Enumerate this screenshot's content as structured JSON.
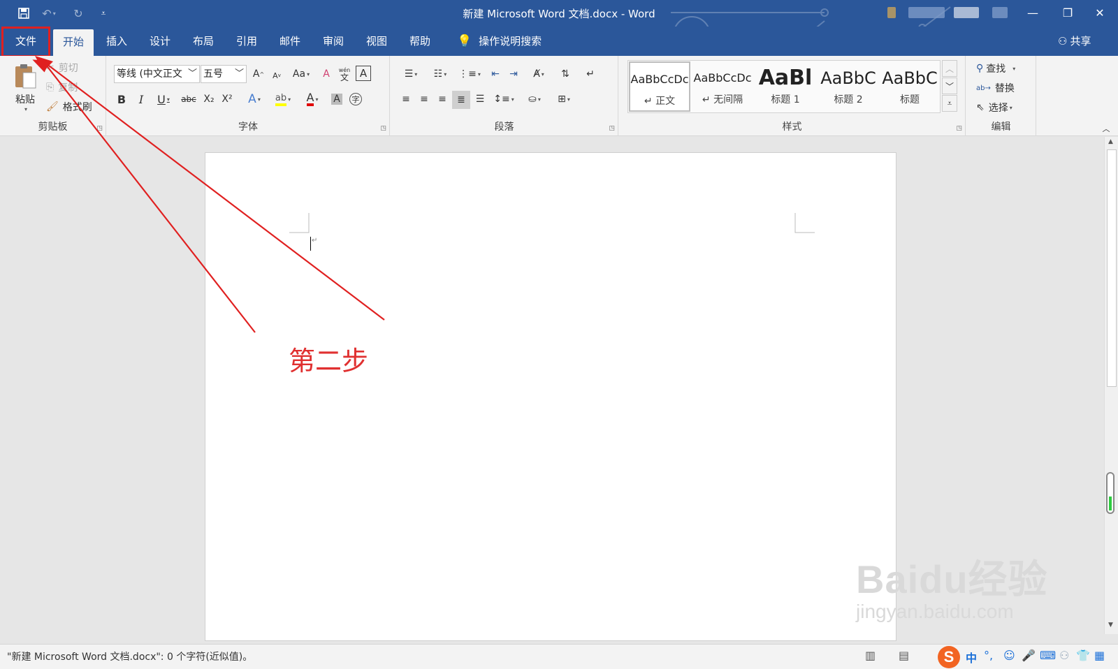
{
  "window": {
    "title": "新建 Microsoft Word 文档.docx  -  Word",
    "controls": {
      "minimize": "—",
      "restore": "❐",
      "close": "✕"
    }
  },
  "qat": {
    "save_icon": "save-icon",
    "undo_icon": "undo-icon",
    "redo_icon": "redo-icon",
    "customize_icon": "customize-qat-icon"
  },
  "tabs": [
    {
      "label": "文件"
    },
    {
      "label": "开始"
    },
    {
      "label": "插入"
    },
    {
      "label": "设计"
    },
    {
      "label": "布局"
    },
    {
      "label": "引用"
    },
    {
      "label": "邮件"
    },
    {
      "label": "审阅"
    },
    {
      "label": "视图"
    },
    {
      "label": "帮助"
    }
  ],
  "tell_me": "操作说明搜索",
  "share": "共享",
  "clipboard": {
    "paste": "粘贴",
    "cut": "剪切",
    "copy": "复制",
    "format_painter": "格式刷",
    "group": "剪贴板"
  },
  "font": {
    "font_name": "等线 (中文正文",
    "font_size": "五号",
    "change_case": "Aa",
    "group": "字体",
    "bold": "B",
    "italic": "I",
    "underline": "U",
    "strikethrough": "abc",
    "subscript": "X₂",
    "superscript": "X²",
    "grow": "A",
    "shrink": "A",
    "phonetic_top": "wén",
    "phonetic_bottom": "文",
    "char_border": "A",
    "enclose": "字"
  },
  "paragraph": {
    "group": "段落"
  },
  "styles": {
    "group": "样式",
    "items": [
      {
        "sample": "AaBbCcDc",
        "name": "↵ 正文"
      },
      {
        "sample": "AaBbCcDc",
        "name": "↵ 无间隔"
      },
      {
        "sample": "AaBl",
        "name": "标题 1"
      },
      {
        "sample": "AaBbC",
        "name": "标题 2"
      },
      {
        "sample": "AaBbC",
        "name": "标题"
      }
    ]
  },
  "editing": {
    "find": "查找",
    "replace": "替换",
    "select": "选择",
    "group": "编辑"
  },
  "status": {
    "text": "\"新建 Microsoft Word 文档.docx\": 0 个字符(近似值)。"
  },
  "ime": {
    "mode": "中",
    "punct": "°,"
  },
  "annotation": {
    "label": "第二步",
    "color": "#e02020"
  },
  "watermark": {
    "logo": "Baidu经验",
    "url": "jingyan.baidu.com"
  },
  "colors": {
    "accent": "#2b579a",
    "highlight": "#ffff00",
    "font_color": "#e00000"
  }
}
